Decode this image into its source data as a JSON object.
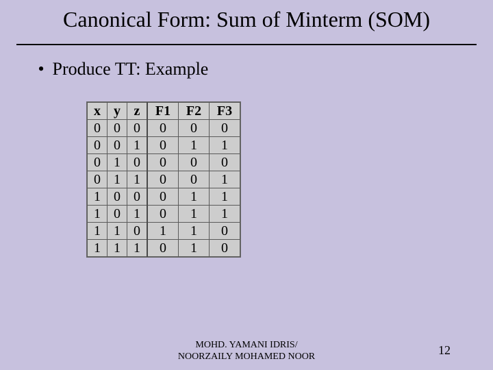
{
  "title": "Canonical Form: Sum of Minterm (SOM)",
  "bullet": "Produce TT: Example",
  "table": {
    "headers": [
      "x",
      "y",
      "z",
      "F1",
      "F2",
      "F3"
    ],
    "rows": [
      [
        "0",
        "0",
        "0",
        "0",
        "0",
        "0"
      ],
      [
        "0",
        "0",
        "1",
        "0",
        "1",
        "1"
      ],
      [
        "0",
        "1",
        "0",
        "0",
        "0",
        "0"
      ],
      [
        "0",
        "1",
        "1",
        "0",
        "0",
        "1"
      ],
      [
        "1",
        "0",
        "0",
        "0",
        "1",
        "1"
      ],
      [
        "1",
        "0",
        "1",
        "0",
        "1",
        "1"
      ],
      [
        "1",
        "1",
        "0",
        "1",
        "1",
        "0"
      ],
      [
        "1",
        "1",
        "1",
        "0",
        "1",
        "0"
      ]
    ]
  },
  "footer": {
    "line1": "MOHD. YAMANI IDRIS/",
    "line2": "NOORZAILY MOHAMED NOOR"
  },
  "page_number": "12",
  "chart_data": {
    "type": "table",
    "title": "Truth table for F1, F2, F3 over inputs x, y, z",
    "columns": [
      "x",
      "y",
      "z",
      "F1",
      "F2",
      "F3"
    ],
    "rows": [
      [
        0,
        0,
        0,
        0,
        0,
        0
      ],
      [
        0,
        0,
        1,
        0,
        1,
        1
      ],
      [
        0,
        1,
        0,
        0,
        0,
        0
      ],
      [
        0,
        1,
        1,
        0,
        0,
        1
      ],
      [
        1,
        0,
        0,
        0,
        1,
        1
      ],
      [
        1,
        0,
        1,
        0,
        1,
        1
      ],
      [
        1,
        1,
        0,
        1,
        1,
        0
      ],
      [
        1,
        1,
        1,
        0,
        1,
        0
      ]
    ]
  }
}
